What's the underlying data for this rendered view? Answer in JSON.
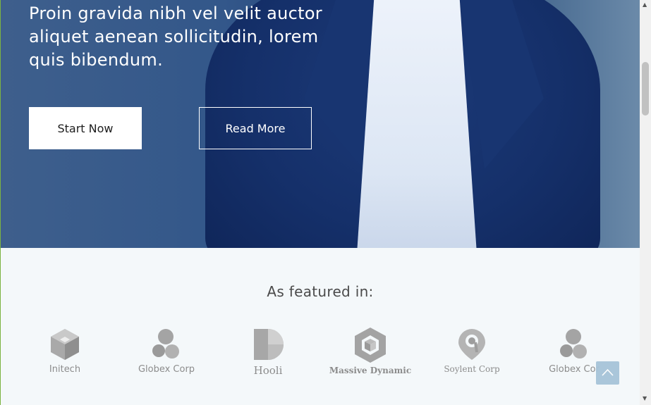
{
  "hero": {
    "tagline": "Proin gravida nibh vel velit auctor aliquet aenean sollicitudin, lorem quis bibendum.",
    "primary_button": "Start Now",
    "secondary_button": "Read More"
  },
  "featured": {
    "title": "As featured in:",
    "logos": [
      {
        "name": "Initech",
        "icon": "initech-cube-icon"
      },
      {
        "name": "Globex Corp",
        "icon": "globex-circles-icon"
      },
      {
        "name": "Hooli",
        "icon": "hooli-leaf-icon"
      },
      {
        "name": "Massive Dynamic",
        "icon": "massive-dynamic-hexagon-icon"
      },
      {
        "name": "Soylent Corp",
        "icon": "soylent-pin-icon"
      },
      {
        "name": "Globex Cor",
        "icon": "globex-circles-icon"
      }
    ]
  },
  "colors": {
    "hero_blue": "#1f3f73",
    "featured_bg": "#f4f8fa",
    "logo_gray": "#8a8a8a",
    "back_to_top": "#a7c4d9"
  }
}
